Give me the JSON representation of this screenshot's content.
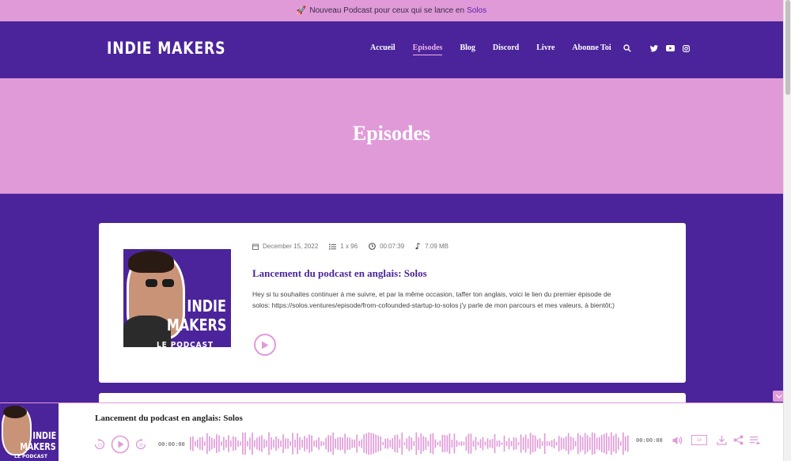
{
  "announcement": {
    "emoji": "🚀",
    "text": "Nouveau Podcast pour ceux qui se lance en",
    "link": "Solos"
  },
  "brand": {
    "logo": "INDIE MAKERS"
  },
  "nav": {
    "items": [
      {
        "label": "Accueil",
        "active": false
      },
      {
        "label": "Episodes",
        "active": true
      },
      {
        "label": "Blog",
        "active": false
      },
      {
        "label": "Discord",
        "active": false
      },
      {
        "label": "Livre",
        "active": false
      },
      {
        "label": "Abonne Toi",
        "active": false
      }
    ],
    "icons": [
      "search-icon",
      "twitter-icon",
      "youtube-icon",
      "instagram-icon"
    ]
  },
  "hero": {
    "title": "Episodes"
  },
  "episode": {
    "date": "December 15, 2022",
    "episode_number": "1 x 96",
    "duration": "00:07:39",
    "size": "7.09 MB",
    "title": "Lancement du podcast en anglais: Solos",
    "description": "Hey si tu souhaites continuer à me suivre, et par la même occasion, taffer ton anglais, voici le lien du premier épisode de solos: https://solos.ventures/episode/from-cofounded-startup-to-solos j'y parle de mon parcours et mes valeurs, à bientôt;)",
    "cover": {
      "line1": "INDIE",
      "line2": "MAKERS",
      "line3": "LE PODCAST"
    }
  },
  "player": {
    "title": "Lancement du podcast en anglais: Solos",
    "time_current": "00:00:00",
    "time_total": "00:00:00",
    "rewind_label": "15",
    "forward_label": "30",
    "speed": "1x",
    "cover": {
      "line1": "INDIE",
      "line2": "MAKERS",
      "line3": "LE PODCAST"
    }
  },
  "colors": {
    "purple": "#4b249b",
    "pink": "#e09ad8",
    "pinkLight": "#f1b4ea"
  }
}
